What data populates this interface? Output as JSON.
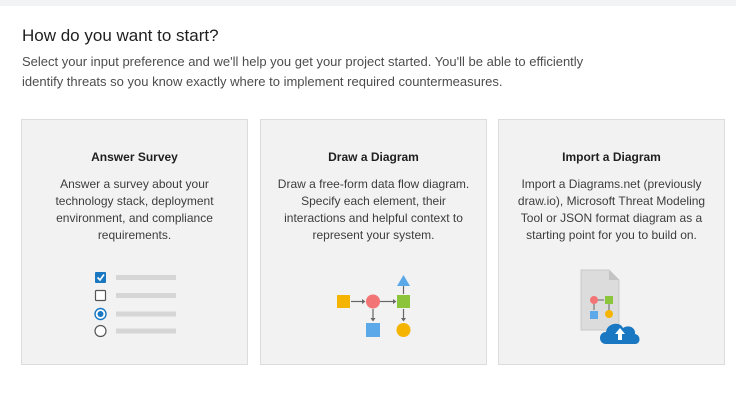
{
  "header": {
    "title": "How do you want to start?",
    "subtitle": "Select your input preference and we'll help you get your project started. You'll be able to efficiently identify threats so you know exactly where to implement required countermeasures."
  },
  "cards": [
    {
      "title": "Answer Survey",
      "description": "Answer a survey about your technology stack, deployment environment, and compliance requirements.",
      "icon": "survey-illustration-icon"
    },
    {
      "title": "Draw a Diagram",
      "description": "Draw a free-form data flow diagram. Specify each element, their interactions and helpful context to represent your system.",
      "icon": "diagram-illustration-icon"
    },
    {
      "title": "Import a Diagram",
      "description": "Import a Diagrams.net (previously draw.io), Microsoft Threat Modeling Tool or JSON format diagram as a starting point for you to build on.",
      "icon": "import-diagram-illustration-icon"
    }
  ],
  "colors": {
    "accent_blue": "#1a78c2",
    "shape_yellow": "#f5b400",
    "shape_red": "#f27474",
    "shape_green": "#8cc43c",
    "shape_lightblue": "#5ba9e8"
  }
}
